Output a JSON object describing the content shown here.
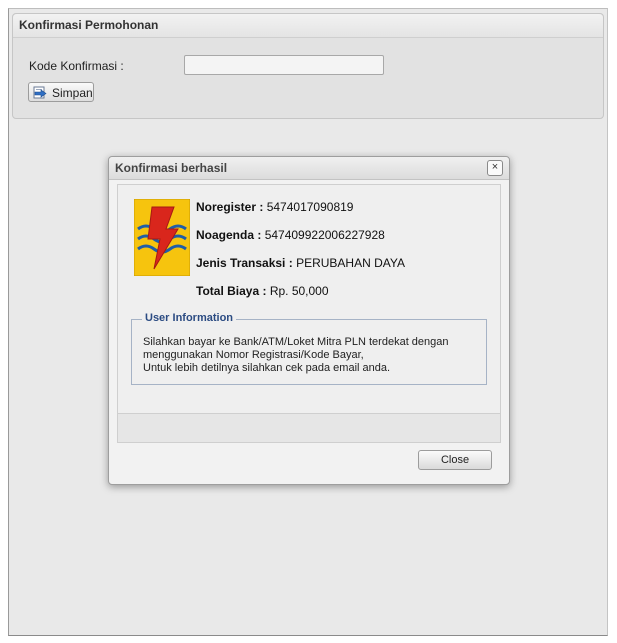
{
  "panel": {
    "title": "Konfirmasi Permohonan",
    "kode_label": "Kode Konfirmasi :",
    "kode_value": "",
    "simpan_label": "Simpan"
  },
  "dialog": {
    "title": "Konfirmasi berhasil",
    "close_x": "×",
    "noregister": {
      "label": "Noregister :",
      "value": "5474017090819"
    },
    "noagenda": {
      "label": "Noagenda :",
      "value": "547409922006227928"
    },
    "jenis": {
      "label": "Jenis Transaksi :",
      "value": "PERUBAHAN DAYA"
    },
    "total": {
      "label": "Total Biaya :",
      "value": "Rp. 50,000"
    },
    "user_info": {
      "legend": "User Information",
      "line1": "Silahkan bayar ke Bank/ATM/Loket Mitra PLN terdekat dengan",
      "line2": "menggunakan Nomor Registrasi/Kode Bayar,",
      "line3": "Untuk lebih detilnya silahkan cek pada email anda."
    },
    "close_label": "Close"
  },
  "icons": {
    "simpan": "save-arrow-icon",
    "logo": "pln-logo-icon"
  },
  "colors": {
    "legend": "#2b4b82",
    "logo_bg": "#f6c40e",
    "logo_red": "#d9261c",
    "logo_blue": "#1f5ea8"
  }
}
